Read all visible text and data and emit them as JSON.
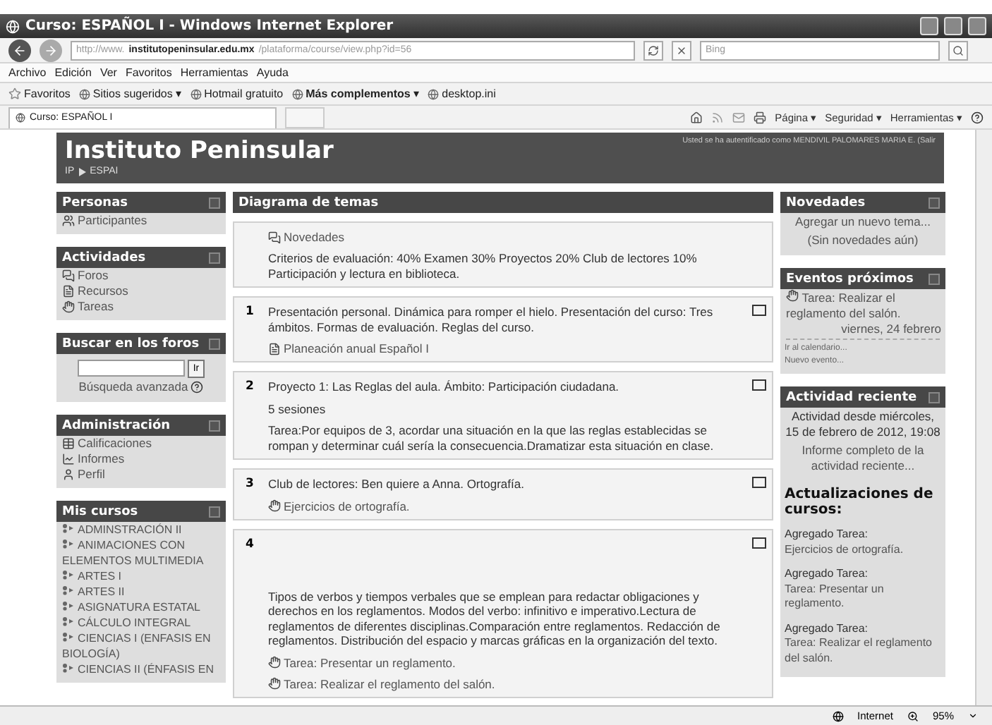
{
  "window": {
    "title": "Curso: ESPAÑOL I - Windows Internet Explorer"
  },
  "address": {
    "prefix": "http://www.",
    "domain": "institutopeninsular.edu.mx",
    "path": "/plataforma/course/view.php?id=56"
  },
  "search": {
    "placeholder": "Bing"
  },
  "menu": [
    "Archivo",
    "Edición",
    "Ver",
    "Favoritos",
    "Herramientas",
    "Ayuda"
  ],
  "favorites": {
    "label": "Favoritos",
    "links": [
      "Sitios sugeridos ▾",
      "Hotmail gratuito",
      "**Más complementos** ▾",
      "desktop.ini"
    ]
  },
  "tab": {
    "label": "Curso: ESPAÑOL I"
  },
  "command_bar": [
    "Página ▾",
    "Seguridad ▾",
    "Herramientas ▾"
  ],
  "header": {
    "site": "Instituto Peninsular",
    "breadcrumb": [
      "IP",
      "ESPAI"
    ],
    "login": "Usted se ha autentificado como MENDIVIL PALOMARES MARIA E. (Salir"
  },
  "left_blocks": [
    {
      "title": "Personas",
      "kind": "list",
      "items": [
        {
          "kind": "people",
          "label": "Participantes"
        }
      ]
    },
    {
      "title": "Actividades",
      "kind": "list",
      "items": [
        {
          "kind": "forum",
          "label": "Foros"
        },
        {
          "kind": "resource",
          "label": "Recursos"
        },
        {
          "kind": "assignment",
          "label": "Tareas"
        }
      ]
    },
    {
      "title": "Buscar en los foros",
      "kind": "search",
      "button": "Ir",
      "link": "Búsqueda avanzada"
    },
    {
      "title": "Administración",
      "kind": "list",
      "items": [
        {
          "kind": "grades",
          "label": "Calificaciones"
        },
        {
          "kind": "chart",
          "label": "Informes"
        },
        {
          "kind": "person",
          "label": "Perfil"
        }
      ]
    },
    {
      "title": "Mis cursos",
      "kind": "courses",
      "items": [
        "ADMINSTRACIÓN II",
        "ANIMACIONES CON ELEMENTOS MULTIMEDIA",
        "ARTES I",
        "ARTES II",
        "ASIGNATURA ESTATAL",
        "CÁLCULO INTEGRAL",
        "CIENCIAS I (ENFASIS EN BIOLOGÍA)",
        "CIENCIAS II (ÉNFASIS EN"
      ]
    }
  ],
  "main": {
    "title": "Diagrama de temas",
    "sections": [
      {
        "items": [
          {
            "kind": "forum",
            "text": "Novedades"
          },
          {
            "kind": "text",
            "text": "Criterios de evaluación: 40% Examen 30% Proyectos 20% Club de lectores 10% Participación y lectura en biblioteca."
          }
        ]
      },
      {
        "number": "1",
        "items": [
          {
            "kind": "text",
            "text": "Presentación personal. Dinámica para romper el hielo. Presentación del curso: Tres ámbitos. Formas de evaluación. Reglas del curso."
          },
          {
            "kind": "resource",
            "text": "Planeación anual Español I"
          }
        ]
      },
      {
        "number": "2",
        "items": [
          {
            "kind": "text",
            "text": "Proyecto 1: Las Reglas del aula. Ámbito: Participación ciudadana."
          },
          {
            "kind": "text",
            "text": "5 sesiones"
          },
          {
            "kind": "text",
            "text": "Tarea:Por equipos de 3, acordar una situación en la que las reglas establecidas se rompan y determinar cuál sería la consecuencia.Dramatizar esta situación en clase."
          }
        ]
      },
      {
        "number": "3",
        "items": [
          {
            "kind": "text",
            "text": "Club de lectores: Ben quiere a Anna.  Ortografía."
          },
          {
            "kind": "assignment",
            "text": "Ejercicios de ortografía."
          }
        ]
      },
      {
        "number": "4",
        "items": [
          {
            "kind": "spacer"
          },
          {
            "kind": "text",
            "text": "Tipos de verbos y tiempos verbales que se emplean para redactar obligaciones y derechos en los reglamentos. Modos del verbo: infinitivo e imperativo.Lectura de reglamentos de diferentes disciplinas.Comparación entre reglamentos. Redacción de reglamentos. Distribución del espacio y marcas gráficas en la organización del texto."
          },
          {
            "kind": "assignment",
            "text": "Tarea: Presentar un reglamento."
          },
          {
            "kind": "assignment",
            "text": "Tarea: Realizar el reglamento del salón."
          }
        ]
      }
    ]
  },
  "news": {
    "title": "Novedades",
    "link": "Agregar un nuevo tema...",
    "note": "(Sin novedades aún)"
  },
  "events": {
    "title": "Eventos próximos",
    "event": "Tarea: Realizar el reglamento del salón.",
    "date": "viernes, 24 febrero",
    "links": [
      "Ir al calendario...",
      "Nuevo evento..."
    ]
  },
  "recent": {
    "title": "Actividad reciente",
    "since": "Actividad desde miércoles, 15 de febrero de 2012, 19:08",
    "report": "Informe completo de la actividad reciente...",
    "heading": "Actualizaciones de cursos:",
    "updates": [
      {
        "title": "Agregado Tarea:",
        "link": "Ejercicios de ortografía."
      },
      {
        "title": "Agregado Tarea:",
        "link": "Tarea: Presentar un reglamento."
      },
      {
        "title": "Agregado Tarea:",
        "link": "Tarea: Realizar el reglamento del salón."
      }
    ]
  },
  "status_bar": {
    "zone": "Internet",
    "zoom": "95%"
  }
}
